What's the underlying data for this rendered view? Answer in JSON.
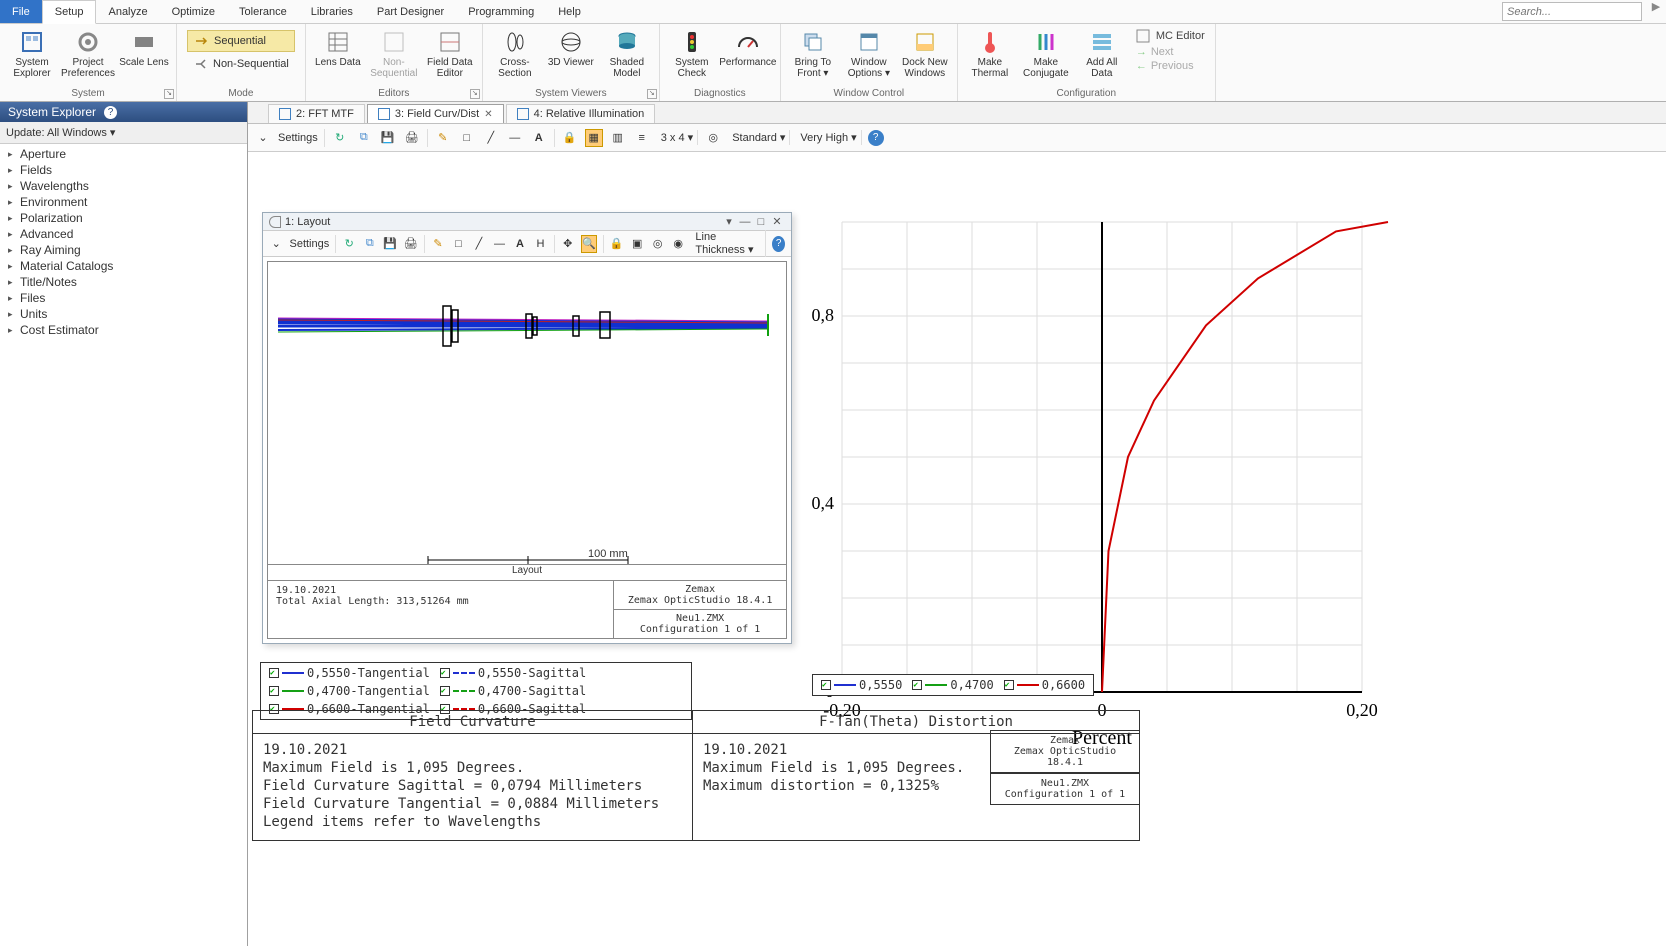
{
  "menu": {
    "file": "File",
    "setup": "Setup",
    "analyze": "Analyze",
    "optimize": "Optimize",
    "tolerance": "Tolerance",
    "libraries": "Libraries",
    "part_designer": "Part Designer",
    "programming": "Programming",
    "help": "Help"
  },
  "search": {
    "placeholder": "Search..."
  },
  "ribbon": {
    "system": {
      "label": "System",
      "explorer": "System\nExplorer",
      "prefs": "Project\nPreferences",
      "scale": "Scale\nLens",
      "launcher_hint": "↘"
    },
    "mode": {
      "label": "Mode",
      "sequential": "Sequential",
      "nonseq": "Non-Sequential"
    },
    "editors": {
      "label": "Editors",
      "lens": "Lens\nData",
      "nonseq": "Non-Sequential",
      "field": "Field Data\nEditor"
    },
    "viewers": {
      "label": "System Viewers",
      "cross": "Cross-Section",
      "viewer3d": "3D\nViewer",
      "shaded": "Shaded\nModel"
    },
    "diag": {
      "label": "Diagnostics",
      "check": "System\nCheck",
      "perf": "Performance"
    },
    "wincontrol": {
      "label": "Window Control",
      "bring": "Bring To\nFront ▾",
      "winopt": "Window\nOptions ▾",
      "dock": "Dock New\nWindows"
    },
    "config": {
      "label": "Configuration",
      "thermal": "Make\nThermal",
      "conjugate": "Make\nConjugate",
      "addall": "Add All\nData",
      "mceditor": "MC Editor",
      "next": "Next",
      "prev": "Previous"
    }
  },
  "syspanel": {
    "title": "System Explorer",
    "helpicon": "?",
    "update": "Update: All Windows ▾",
    "items": [
      "Aperture",
      "Fields",
      "Wavelengths",
      "Environment",
      "Polarization",
      "Advanced",
      "Ray Aiming",
      "Material Catalogs",
      "Title/Notes",
      "Files",
      "Units",
      "Cost Estimator"
    ]
  },
  "tabs": {
    "t2": "2: FFT MTF",
    "t3": "3: Field Curv/Dist",
    "t4": "4: Relative Illumination"
  },
  "toolbar": {
    "settings": "Settings",
    "grid": "3 x 4 ▾",
    "standard": "Standard ▾",
    "quality": "Very High ▾",
    "line_thickness": "Line Thickness ▾"
  },
  "layout_win": {
    "title": "1: Layout",
    "scalebar": "100 mm",
    "caption": "Layout",
    "footer_date": "19.10.2021",
    "footer_axial": "Total Axial Length:  313,51264 mm",
    "footer_brand": "Zemax",
    "footer_product": "Zemax OpticStudio 18.4.1",
    "footer_file": "Neu1.ZMX",
    "footer_conf": "Configuration 1 of 1"
  },
  "chart_data": {
    "type": "line",
    "title": "F-Tan(Theta) Distortion",
    "xlabel": "Percent",
    "ylabel": "",
    "xlim": [
      -0.2,
      0.2
    ],
    "ylim": [
      0,
      1.0
    ],
    "y_ticks": [
      0,
      0.4,
      0.8
    ],
    "x_ticks": [
      -0.2,
      0,
      0.2
    ],
    "x_tick_labels": [
      "-0,20",
      "0",
      "0,20"
    ],
    "y_tick_labels": [
      "0",
      "0,4",
      "0,8"
    ],
    "series": [
      {
        "name": "0,6600",
        "color": "#d00000",
        "points": [
          [
            0.0,
            0.0
          ],
          [
            0.005,
            0.3
          ],
          [
            0.02,
            0.5
          ],
          [
            0.04,
            0.62
          ],
          [
            0.08,
            0.78
          ],
          [
            0.12,
            0.88
          ],
          [
            0.18,
            0.98
          ],
          [
            0.22,
            1.0
          ]
        ]
      }
    ]
  },
  "legend_fc": {
    "items": [
      {
        "label": "0,5550-Tangential",
        "color": "#2030d0",
        "dash": false
      },
      {
        "label": "0,5550-Sagittal",
        "color": "#2030d0",
        "dash": true
      },
      {
        "label": "0,4700-Tangential",
        "color": "#15a015",
        "dash": false
      },
      {
        "label": "0,4700-Sagittal",
        "color": "#15a015",
        "dash": true
      },
      {
        "label": "0,6600-Tangential",
        "color": "#d00000",
        "dash": false
      },
      {
        "label": "0,6600-Sagittal",
        "color": "#d00000",
        "dash": true
      }
    ]
  },
  "legend_dist": {
    "items": [
      {
        "label": "0,5550",
        "color": "#2030d0"
      },
      {
        "label": "0,4700",
        "color": "#15a015"
      },
      {
        "label": "0,6600",
        "color": "#d00000"
      }
    ]
  },
  "databoxes": {
    "fc_title": "Field Curvature",
    "dist_title": "F-Tan(Theta) Distortion",
    "date": "19.10.2021",
    "maxfield": "Maximum Field is 1,095 Degrees.",
    "fc_sag": "Field Curvature Sagittal = 0,0794 Millimeters",
    "fc_tan": "Field Curvature Tangential = 0,0884 Millimeters",
    "fc_legend_note": "Legend items refer to Wavelengths",
    "dist_max": "Maximum distortion = 0,1325%",
    "brand": "Zemax",
    "product": "Zemax OpticStudio 18.4.1",
    "file": "Neu1.ZMX",
    "conf": "Configuration 1 of 1"
  }
}
